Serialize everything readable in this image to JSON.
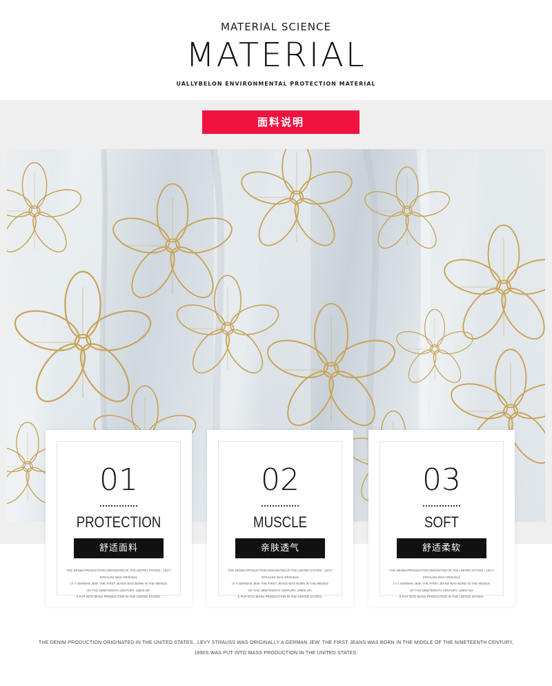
{
  "header": {
    "kicker": "MATERIAL SCIENCE",
    "headline": "MATERIAL",
    "subline": "UALLYBELON ENVIRONMENTAL PROTECTION MATERIAL"
  },
  "banner": {
    "label": "面料说明",
    "color": "#f0123f"
  },
  "photo": {
    "description_icon": "fabric-photo",
    "motif_color": "#c9a45a"
  },
  "cards": [
    {
      "number": "01",
      "title": "PROTECTION",
      "label": "舒适面料",
      "body": [
        "THE DENIM PRODUCTION ORIGINATED IN THE UNITED STATES., LEVY STRAUSS WAS ORIGINAL",
        "LY A GERMAN JEW. THE FIRST JEANS WAS BORN IN THE MIDDLE",
        "OF THE NINETEENTH CENTURY, 1850S WA",
        "S PUT INTO MASS PRODUCTION IN THE UNITED STATES."
      ]
    },
    {
      "number": "02",
      "title": "MUSCLE",
      "label": "亲肤透气",
      "body": [
        "THE DENIM PRODUCTION ORIGINATED IN THE UNITED STATES., LEVY STRAUSS WAS ORIGINAL",
        "LY A GERMAN JEW. THE FIRST JEANS WAS BORN IN THE MIDDLE",
        "OF THE NINETEENTH CENTURY, 1850S WA",
        "S PUT INTO MASS PRODUCTION IN THE UNITED STATES."
      ]
    },
    {
      "number": "03",
      "title": "SOFT",
      "label": "舒适柔软",
      "body": [
        "THE DENIM PRODUCTION ORIGINATED IN THE UNITED STATES., LEVY STRAUSS WAS ORIGINAL",
        "LY A GERMAN JEW. THE FIRST JEANS WAS BORN IN THE MIDDLE",
        "OF THE NINETEENTH CENTURY, 1850S WA",
        "S PUT INTO MASS PRODUCTION IN THE UNITED STATES."
      ]
    }
  ],
  "footer": {
    "line1": "THE DENIM PRODUCTION ORIGINATED IN THE UNITED STATES., LEVY STRAUSS WAS ORIGINALLY A GERMAN JEW. THE FIRST JEANS WAS BORN IN THE MIDDLE OF THE NINETEENTH CENTURY,",
    "line2": "1890S WAS PUT INTO MASS PRODUCTION IN THE UNITED STATES."
  }
}
